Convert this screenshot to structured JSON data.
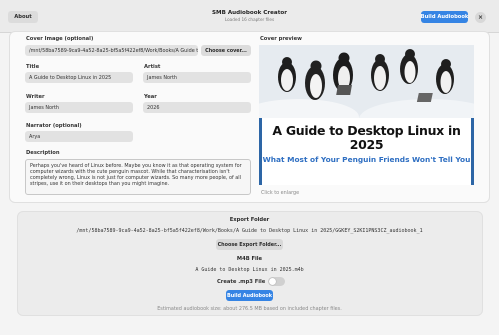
{
  "header": {
    "about_label": "About",
    "title": "SMB Audiobook Creator",
    "subtitle": "Loaded 16 chapter files",
    "build_label": "Build Audiobook",
    "close_symbol": "×"
  },
  "form": {
    "cover_image_label": "Cover Image (optional)",
    "cover_image_value": "/mnt/58ba7589-9ca9-4a52-8a25-bf5a5f422ef8/Work/Books/A Guide to Desktop Linux in 2025/",
    "choose_cover_label": "Choose cover...",
    "title_label": "Title",
    "title_value": "A Guide to Desktop Linux in 2025",
    "artist_label": "Artist",
    "artist_value": "James North",
    "writer_label": "Writer",
    "writer_value": "James North",
    "year_label": "Year",
    "year_value": "2026",
    "narrator_label": "Narrator (optional)",
    "narrator_value": "Arya",
    "description_label": "Description",
    "description_value": "Perhaps you've heard of Linux before. Maybe you know it as that operating system for computer wizards with the cute penguin mascot. While that characterisation isn't completely wrong, Linux is not just for computer wizards. So many more people, of all stripes, use it on their desktops than you might imagine."
  },
  "cover_preview": {
    "label": "Cover preview",
    "book_title": "A Guide to Desktop Linux in 2025",
    "book_subtitle": "What Most of Your Penguin Friends Won't Tell You",
    "click_hint": "Click to enlarge",
    "background_color": "#2d66a6"
  },
  "export": {
    "folder_label": "Export Folder",
    "folder_path": "/mnt/58ba7589-9ca9-4a52-8a25-bf5a5f422ef8/Work/Books/A Guide to Desktop Linux in 2025/GGKEY_S2KI1PNS3CZ_audiobook_1",
    "choose_folder_label": "Choose Export Folder...",
    "m4b_label": "M4B File",
    "m4b_value": "A Guide to Desktop Linux in 2025.m4b",
    "mp3_label": "Create .mp3 File",
    "mp3_enabled": false,
    "build_label": "Build Audiobook",
    "estimate": "Estimated audiobook size: about 276.5 MB based on included chapter files."
  },
  "colors": {
    "accent": "#3584e4"
  }
}
